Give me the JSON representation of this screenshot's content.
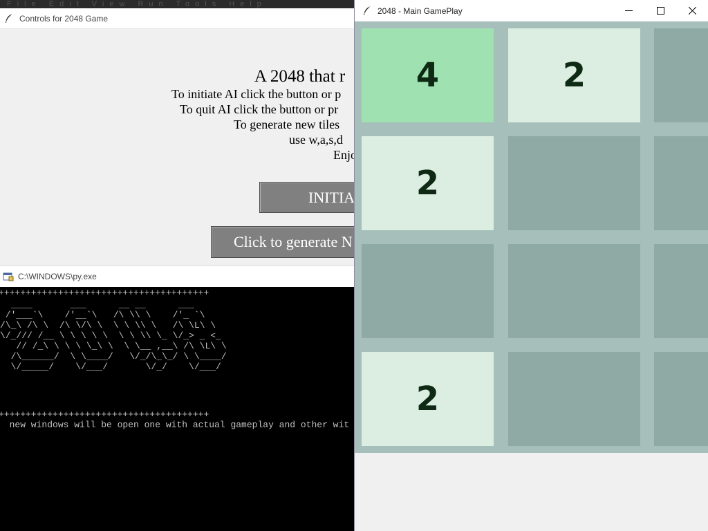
{
  "top_ghost": "File  Edit  View  Run  Tools  Help",
  "controls_window": {
    "title": "Controls for 2048 Game",
    "heading": "A 2048 that r",
    "lines": [
      "To initiate AI click the button or p",
      "To quit AI click the button or pr",
      "To generate new tiles",
      "use w,a,s,d",
      "Enjo"
    ],
    "initiate_button": "INITIA",
    "generate_button": "Click to generate N"
  },
  "console_window": {
    "title": "C:\\WINDOWS\\py.exe",
    "rule": "+++++++++++++++++++++++++++++++++++++++",
    "ascii_art": [
      "  ____       ___      __ __      ___",
      " /'___`\\    /'__`\\   /\\ \\\\ \\    /'_ `\\",
      "/\\_\\ /\\ \\  /\\ \\/\\ \\  \\ \\ \\\\ \\   /\\ \\L\\ \\",
      "\\/_/// /__ \\ \\ \\ \\ \\  \\ \\ \\\\ \\_ \\/_> _ <_",
      "   // /_\\ \\ \\ \\ \\_\\ \\  \\ \\__ ,__\\ /\\ \\L\\ \\",
      "  /\\______/  \\ \\____/   \\/_/\\_\\_/ \\ \\____/",
      "  \\/_____/    \\/___/       \\/_/    \\/___/"
    ],
    "message": "  new windows will be open one with actual gameplay and other wit"
  },
  "game_window": {
    "title": "2048 - Main GamePlay",
    "window_buttons": [
      "minimize",
      "maximize",
      "close"
    ],
    "grid": [
      [
        "4",
        "2",
        ""
      ],
      [
        "2",
        "",
        ""
      ],
      [
        "",
        "",
        ""
      ],
      [
        "2",
        "",
        ""
      ]
    ],
    "colors": {
      "board": "#a6bfba",
      "empty_tile": "#8faaa5",
      "tile_2": "#dcede1",
      "tile_4": "#9fe1b1",
      "tile_text": "#0e2a14"
    }
  }
}
